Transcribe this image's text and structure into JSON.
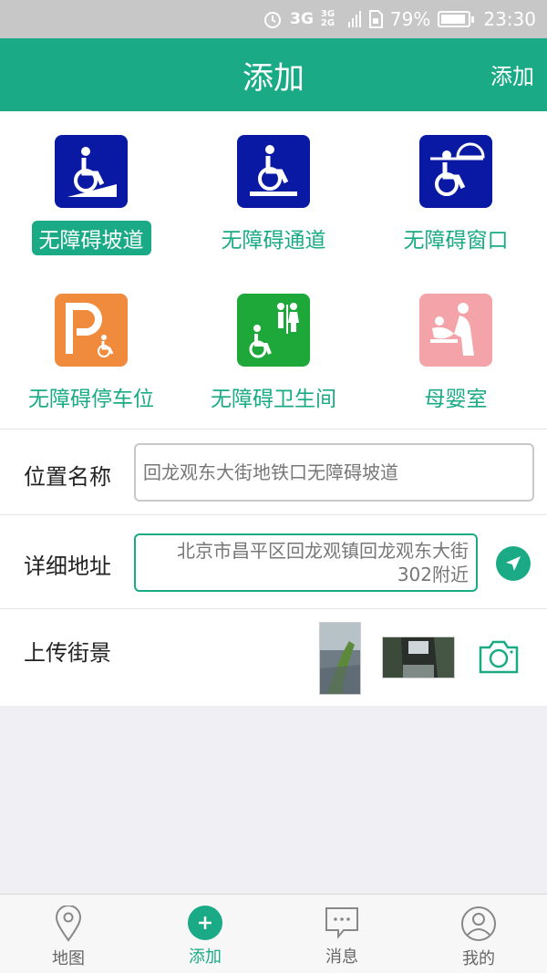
{
  "status_bar": {
    "network": "3G",
    "network2": "3G 2G",
    "battery": "79%",
    "battery_level": 0.79,
    "time": "23:30"
  },
  "app_bar": {
    "title": "添加",
    "action": "添加"
  },
  "facility_types": [
    {
      "label": "无障碍坡道",
      "icon": "wheelchair-ramp-icon",
      "color": "#0a19a3",
      "selected": true
    },
    {
      "label": "无障碍通道",
      "icon": "wheelchair-passage-icon",
      "color": "#0a19a3",
      "selected": false
    },
    {
      "label": "无障碍窗口",
      "icon": "wheelchair-window-icon",
      "color": "#0a19a3",
      "selected": false
    },
    {
      "label": "无障碍停车位",
      "icon": "accessible-parking-icon",
      "color": "#f08a3c",
      "selected": false
    },
    {
      "label": "无障碍卫生间",
      "icon": "accessible-toilet-icon",
      "color": "#1fa83a",
      "selected": false
    },
    {
      "label": "母婴室",
      "icon": "mother-baby-room-icon",
      "color": "#f4a3a8",
      "selected": false
    }
  ],
  "form": {
    "location_name_label": "位置名称",
    "location_name_value": "回龙观东大街地铁口无障碍坡道",
    "address_label": "详细地址",
    "address_value": "北京市昌平区回龙观镇回龙观东大街302附近",
    "upload_label": "上传街景"
  },
  "tabs": [
    {
      "label": "地图",
      "icon": "map-pin-icon",
      "active": false
    },
    {
      "label": "添加",
      "icon": "plus-icon",
      "active": true
    },
    {
      "label": "消息",
      "icon": "message-icon",
      "active": false
    },
    {
      "label": "我的",
      "icon": "user-icon",
      "active": false
    }
  ],
  "colors": {
    "accent": "#1aab86",
    "status_bar": "#c7c7c7"
  }
}
